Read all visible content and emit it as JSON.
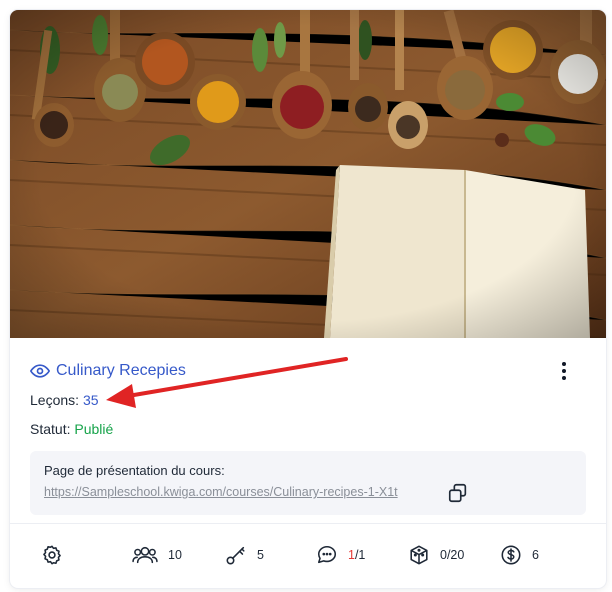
{
  "course": {
    "title": "Culinary Recepies",
    "lessons_label": "Leçons:",
    "lessons_count": "35",
    "status_label": "Statut:",
    "status_value": "Publié"
  },
  "landing": {
    "label": "Page de présentation du cours:",
    "url": "https://Sampleschool.kwiga.com/courses/Culinary-recipes-1-X1t"
  },
  "stats": {
    "students": "10",
    "access_keys": "5",
    "comments_new": "1",
    "comments_total": "/1",
    "tests": "0/20",
    "offers": "6"
  },
  "colors": {
    "link": "#3659c9",
    "published": "#16a34a",
    "arrow": "#e02424",
    "comment_new": "#e53935"
  },
  "icons": [
    "eye-icon",
    "more-vertical-icon",
    "copy-icon",
    "gear-icon",
    "users-icon",
    "key-icon",
    "chat-icon",
    "cube-icon",
    "dollar-icon"
  ]
}
